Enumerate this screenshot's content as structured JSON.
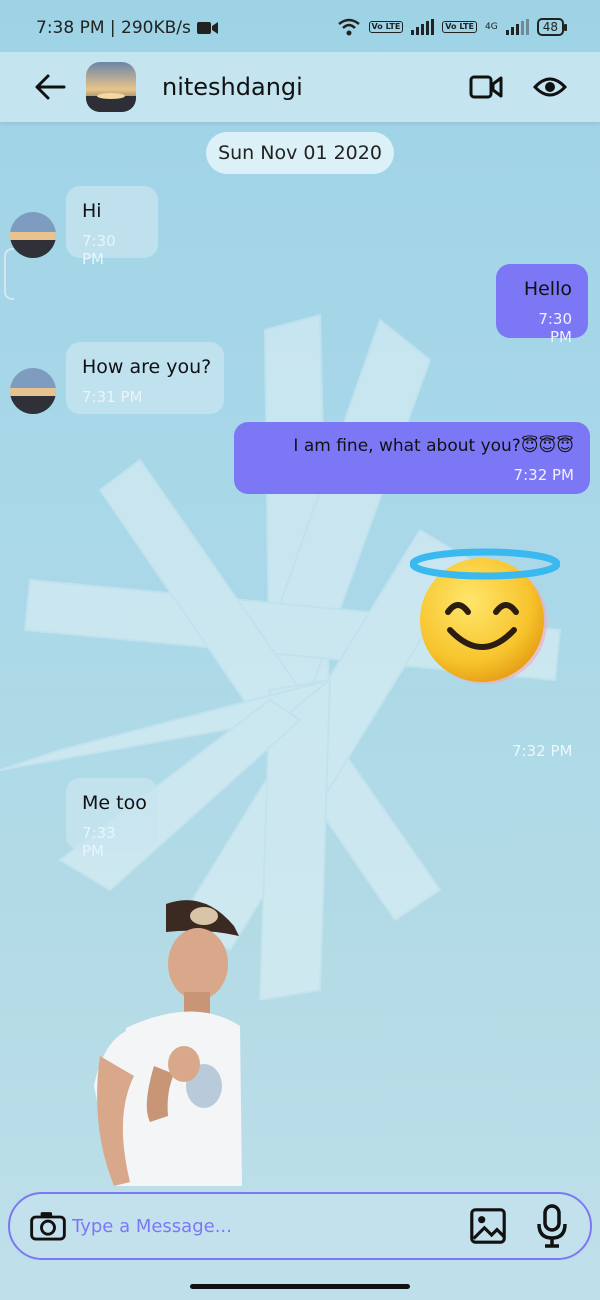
{
  "status_bar": {
    "time_speed": "7:38 PM | 290KB/s",
    "network_tag_1": "Vo LTE",
    "network_tag_2": "Vo LTE",
    "network_type": "4G",
    "battery": "48"
  },
  "header": {
    "contact_name": "niteshdangi"
  },
  "chat": {
    "date": "Sun Nov 01 2020",
    "messages": [
      {
        "direction": "in",
        "text": "Hi",
        "time": "7:30 PM"
      },
      {
        "direction": "out",
        "text": "Hello",
        "time": "7:30 PM"
      },
      {
        "direction": "in",
        "text": "How are you?",
        "time": "7:31 PM"
      },
      {
        "direction": "out",
        "text": "I am fine, what about you?😇😇😇",
        "time": "7:32 PM"
      },
      {
        "direction": "out",
        "type": "sticker",
        "sticker": "smiling-face-with-halo",
        "time": "7:32 PM"
      },
      {
        "direction": "in",
        "text": "Me too",
        "time": "7:33 PM"
      },
      {
        "direction": "in",
        "type": "sticker",
        "sticker": "man-in-cap-gesturing"
      }
    ]
  },
  "composer": {
    "placeholder": "Type a Message..."
  },
  "colors": {
    "accent": "#7c78f5",
    "background": "#a9d8e8"
  }
}
